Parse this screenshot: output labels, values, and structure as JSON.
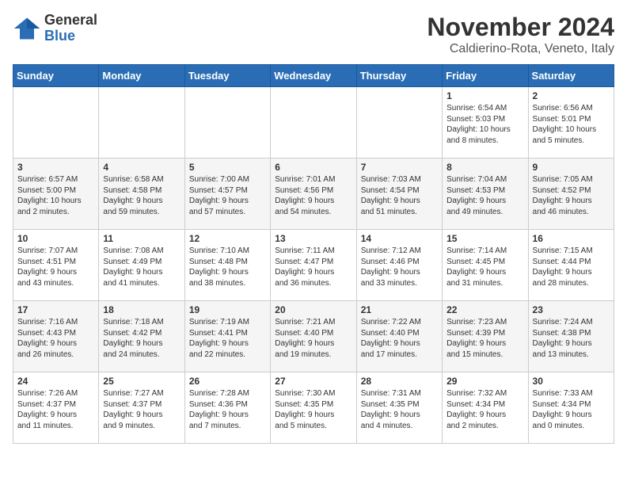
{
  "logo": {
    "general": "General",
    "blue": "Blue"
  },
  "header": {
    "month": "November 2024",
    "location": "Caldierino-Rota, Veneto, Italy"
  },
  "weekdays": [
    "Sunday",
    "Monday",
    "Tuesday",
    "Wednesday",
    "Thursday",
    "Friday",
    "Saturday"
  ],
  "weeks": [
    [
      {
        "day": "",
        "info": ""
      },
      {
        "day": "",
        "info": ""
      },
      {
        "day": "",
        "info": ""
      },
      {
        "day": "",
        "info": ""
      },
      {
        "day": "",
        "info": ""
      },
      {
        "day": "1",
        "info": "Sunrise: 6:54 AM\nSunset: 5:03 PM\nDaylight: 10 hours\nand 8 minutes."
      },
      {
        "day": "2",
        "info": "Sunrise: 6:56 AM\nSunset: 5:01 PM\nDaylight: 10 hours\nand 5 minutes."
      }
    ],
    [
      {
        "day": "3",
        "info": "Sunrise: 6:57 AM\nSunset: 5:00 PM\nDaylight: 10 hours\nand 2 minutes."
      },
      {
        "day": "4",
        "info": "Sunrise: 6:58 AM\nSunset: 4:58 PM\nDaylight: 9 hours\nand 59 minutes."
      },
      {
        "day": "5",
        "info": "Sunrise: 7:00 AM\nSunset: 4:57 PM\nDaylight: 9 hours\nand 57 minutes."
      },
      {
        "day": "6",
        "info": "Sunrise: 7:01 AM\nSunset: 4:56 PM\nDaylight: 9 hours\nand 54 minutes."
      },
      {
        "day": "7",
        "info": "Sunrise: 7:03 AM\nSunset: 4:54 PM\nDaylight: 9 hours\nand 51 minutes."
      },
      {
        "day": "8",
        "info": "Sunrise: 7:04 AM\nSunset: 4:53 PM\nDaylight: 9 hours\nand 49 minutes."
      },
      {
        "day": "9",
        "info": "Sunrise: 7:05 AM\nSunset: 4:52 PM\nDaylight: 9 hours\nand 46 minutes."
      }
    ],
    [
      {
        "day": "10",
        "info": "Sunrise: 7:07 AM\nSunset: 4:51 PM\nDaylight: 9 hours\nand 43 minutes."
      },
      {
        "day": "11",
        "info": "Sunrise: 7:08 AM\nSunset: 4:49 PM\nDaylight: 9 hours\nand 41 minutes."
      },
      {
        "day": "12",
        "info": "Sunrise: 7:10 AM\nSunset: 4:48 PM\nDaylight: 9 hours\nand 38 minutes."
      },
      {
        "day": "13",
        "info": "Sunrise: 7:11 AM\nSunset: 4:47 PM\nDaylight: 9 hours\nand 36 minutes."
      },
      {
        "day": "14",
        "info": "Sunrise: 7:12 AM\nSunset: 4:46 PM\nDaylight: 9 hours\nand 33 minutes."
      },
      {
        "day": "15",
        "info": "Sunrise: 7:14 AM\nSunset: 4:45 PM\nDaylight: 9 hours\nand 31 minutes."
      },
      {
        "day": "16",
        "info": "Sunrise: 7:15 AM\nSunset: 4:44 PM\nDaylight: 9 hours\nand 28 minutes."
      }
    ],
    [
      {
        "day": "17",
        "info": "Sunrise: 7:16 AM\nSunset: 4:43 PM\nDaylight: 9 hours\nand 26 minutes."
      },
      {
        "day": "18",
        "info": "Sunrise: 7:18 AM\nSunset: 4:42 PM\nDaylight: 9 hours\nand 24 minutes."
      },
      {
        "day": "19",
        "info": "Sunrise: 7:19 AM\nSunset: 4:41 PM\nDaylight: 9 hours\nand 22 minutes."
      },
      {
        "day": "20",
        "info": "Sunrise: 7:21 AM\nSunset: 4:40 PM\nDaylight: 9 hours\nand 19 minutes."
      },
      {
        "day": "21",
        "info": "Sunrise: 7:22 AM\nSunset: 4:40 PM\nDaylight: 9 hours\nand 17 minutes."
      },
      {
        "day": "22",
        "info": "Sunrise: 7:23 AM\nSunset: 4:39 PM\nDaylight: 9 hours\nand 15 minutes."
      },
      {
        "day": "23",
        "info": "Sunrise: 7:24 AM\nSunset: 4:38 PM\nDaylight: 9 hours\nand 13 minutes."
      }
    ],
    [
      {
        "day": "24",
        "info": "Sunrise: 7:26 AM\nSunset: 4:37 PM\nDaylight: 9 hours\nand 11 minutes."
      },
      {
        "day": "25",
        "info": "Sunrise: 7:27 AM\nSunset: 4:37 PM\nDaylight: 9 hours\nand 9 minutes."
      },
      {
        "day": "26",
        "info": "Sunrise: 7:28 AM\nSunset: 4:36 PM\nDaylight: 9 hours\nand 7 minutes."
      },
      {
        "day": "27",
        "info": "Sunrise: 7:30 AM\nSunset: 4:35 PM\nDaylight: 9 hours\nand 5 minutes."
      },
      {
        "day": "28",
        "info": "Sunrise: 7:31 AM\nSunset: 4:35 PM\nDaylight: 9 hours\nand 4 minutes."
      },
      {
        "day": "29",
        "info": "Sunrise: 7:32 AM\nSunset: 4:34 PM\nDaylight: 9 hours\nand 2 minutes."
      },
      {
        "day": "30",
        "info": "Sunrise: 7:33 AM\nSunset: 4:34 PM\nDaylight: 9 hours\nand 0 minutes."
      }
    ]
  ]
}
